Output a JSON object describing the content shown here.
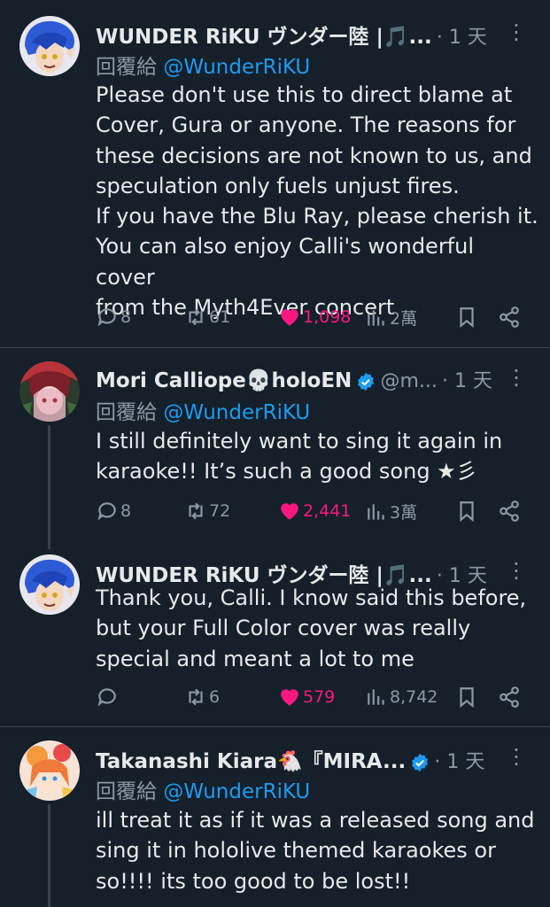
{
  "tweets": [
    {
      "name": "WUNDER RiKU ヴンダー陸 |🎵...",
      "handle": "",
      "time": "· 1 天",
      "reply_prefix": "回覆給",
      "reply_handle": "@WunderRiKU",
      "text": "Please don't use this to direct blame at\nCover, Gura or anyone. The reasons for\nthese decisions are not known to us, and\nspeculation only fuels unjust fires.\nIf you have the Blu Ray, please cherish it.\nYou can also enjoy Calli's wonderful cover\nfrom the Myth4Ever concert",
      "replies": "8",
      "retweets": "61",
      "likes": "1,098",
      "views": "2萬"
    },
    {
      "name": "Mori Calliope💀holoEN",
      "handle": "@m...",
      "time": "· 1 天",
      "reply_prefix": "回覆給",
      "reply_handle": "@WunderRiKU",
      "text": "I still definitely want to sing it again in\nkaraoke!! It’s such a good song ★彡",
      "replies": "8",
      "retweets": "72",
      "likes": "2,441",
      "views": "3萬"
    },
    {
      "name": "WUNDER RiKU ヴンダー陸 |🎵...",
      "handle": "",
      "time": "· 1 天",
      "text": "Thank you, Calli. I know said this before,\nbut your Full Color cover was really\nspecial and meant a lot to me",
      "replies": "",
      "retweets": "6",
      "likes": "579",
      "views": "8,742"
    },
    {
      "name": "Takanashi Kiara🐔『MIRA...",
      "handle": "",
      "time": "· 1 天",
      "reply_prefix": "回覆給",
      "reply_handle": "@WunderRiKU",
      "text": "ill treat it as if it was a released song and\nsing it in hololive themed karaokes or\nso!!!! its too good to be lost!!"
    }
  ],
  "colors": {
    "background": "#15202b",
    "accent": "#1d9bf0",
    "like": "#f91880",
    "muted": "#8b98a5"
  }
}
